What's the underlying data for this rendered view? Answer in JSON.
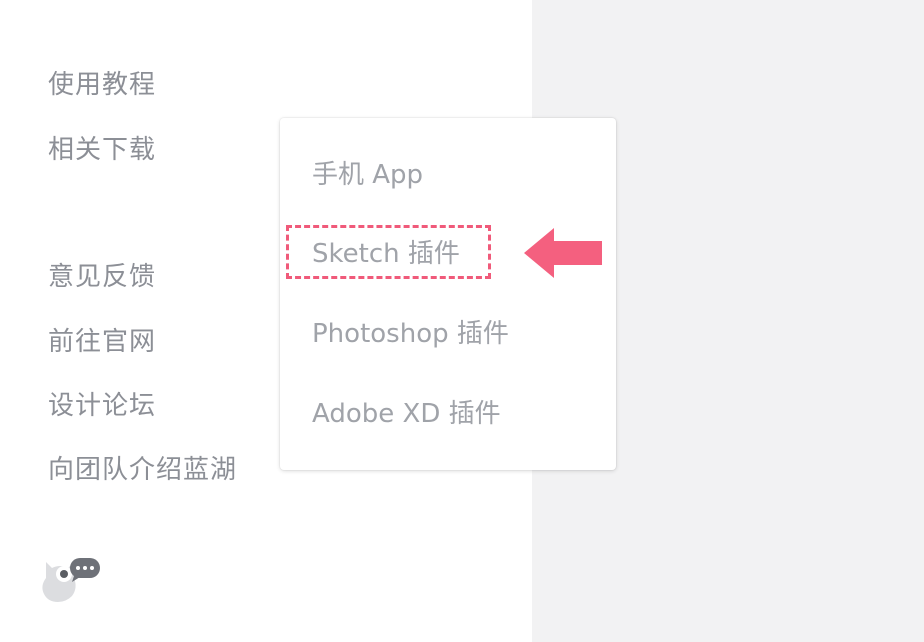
{
  "sidebar": {
    "items": [
      {
        "label": "使用教程"
      },
      {
        "label": "相关下载"
      },
      {
        "label": "意见反馈"
      },
      {
        "label": "前往官网"
      },
      {
        "label": "设计论坛"
      },
      {
        "label": "向团队介绍蓝湖"
      }
    ]
  },
  "downloads_popup": {
    "items": [
      {
        "label": "手机 App"
      },
      {
        "label": "Sketch 插件"
      },
      {
        "label": "Photoshop 插件"
      },
      {
        "label": "Adobe XD 插件"
      }
    ],
    "highlighted_item": "Sketch 插件"
  },
  "colors": {
    "highlight": "#f05a7a",
    "arrow": "#f4607f",
    "text": "#8c8f96",
    "panel_bg": "#f2f2f3"
  },
  "icons": {
    "arrow": "left-arrow-icon",
    "assistant": "chat-bot-icon"
  }
}
